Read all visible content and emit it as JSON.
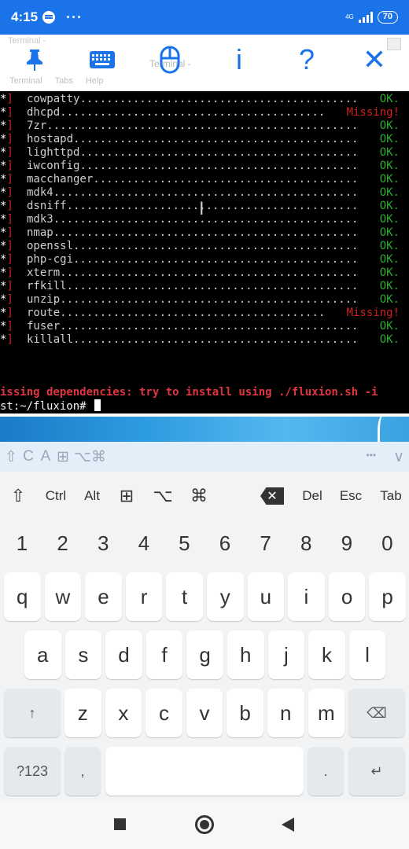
{
  "status_bar": {
    "time": "4:15",
    "network": "4G",
    "battery": "70"
  },
  "toolbar": {
    "ghost_title": "Terminal -",
    "ghost_center": "Terminal -",
    "ghost_menu": [
      "Terminal",
      "Tabs",
      "Help"
    ],
    "info_icon": "i",
    "help_icon": "?",
    "close_icon": "✕",
    "accent": "#1a73e8"
  },
  "terminal": {
    "rows": [
      {
        "name": "cowpatty",
        "status": "OK."
      },
      {
        "name": "dhcpd",
        "status": "Missing!"
      },
      {
        "name": "7zr",
        "status": "OK."
      },
      {
        "name": "hostapd",
        "status": "OK."
      },
      {
        "name": "lighttpd",
        "status": "OK."
      },
      {
        "name": "iwconfig",
        "status": "OK."
      },
      {
        "name": "macchanger",
        "status": "OK."
      },
      {
        "name": "mdk4",
        "status": "OK."
      },
      {
        "name": "dsniff",
        "status": "OK."
      },
      {
        "name": "mdk3",
        "status": "OK."
      },
      {
        "name": "nmap",
        "status": "OK."
      },
      {
        "name": "openssl",
        "status": "OK."
      },
      {
        "name": "php-cgi",
        "status": "OK."
      },
      {
        "name": "xterm",
        "status": "OK."
      },
      {
        "name": "rfkill",
        "status": "OK."
      },
      {
        "name": "unzip",
        "status": "OK."
      },
      {
        "name": "route",
        "status": "Missing!"
      },
      {
        "name": "fuser",
        "status": "OK."
      },
      {
        "name": "killall",
        "status": "OK."
      }
    ],
    "error_line": "issing dependencies: try to install using ./fluxion.sh -i",
    "prompt": "st:~/fluxion#",
    "colors": {
      "ok": "#2ea82e",
      "missing": "#d02020",
      "bracket": "#d02020"
    }
  },
  "suggest_bar": {
    "left_icons": [
      "⇧",
      "C",
      "A",
      "⊞",
      "⌥",
      "⌘"
    ],
    "right_icons": [
      "•••",
      "∨"
    ]
  },
  "modifier_row": {
    "keys": [
      "⇧",
      "Ctrl",
      "Alt",
      "⊞",
      "⌥",
      "⌘",
      "✕",
      "Del",
      "Esc",
      "Tab"
    ]
  },
  "number_row": [
    "1",
    "2",
    "3",
    "4",
    "5",
    "6",
    "7",
    "8",
    "9",
    "0"
  ],
  "keys": {
    "row1": [
      "q",
      "w",
      "e",
      "r",
      "t",
      "y",
      "u",
      "i",
      "o",
      "p"
    ],
    "row2": [
      "a",
      "s",
      "d",
      "f",
      "g",
      "h",
      "j",
      "k",
      "l"
    ],
    "row3": [
      "z",
      "x",
      "c",
      "v",
      "b",
      "n",
      "m"
    ],
    "shift": "↑",
    "backspace": "⌫",
    "symbols": "?123",
    "comma": ",",
    "period": ".",
    "enter": "↵"
  }
}
